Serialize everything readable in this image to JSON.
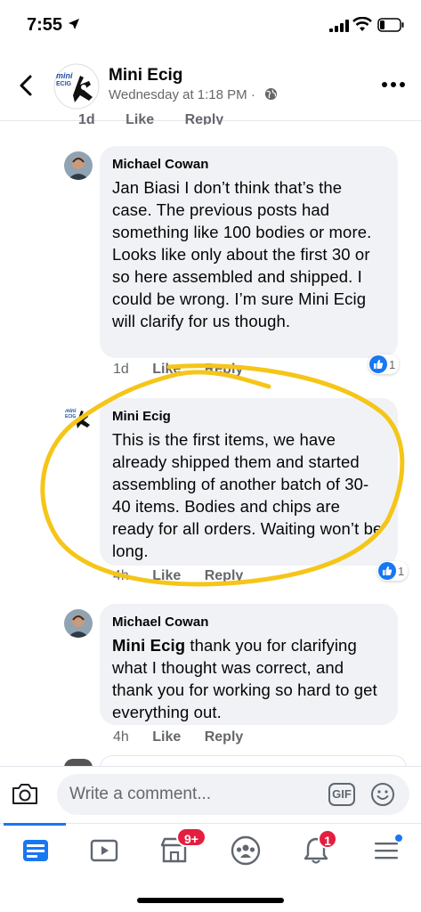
{
  "status_bar": {
    "time": "7:55"
  },
  "header": {
    "page_name": "Mini Ecig",
    "post_meta": "Wednesday at 1:18 PM ·",
    "avatar_logo_text": "mini ECIG"
  },
  "partial_row": {
    "time": "1d",
    "like": "Like",
    "reply": "Reply"
  },
  "comments": [
    {
      "author": "Michael Cowan",
      "text": "Jan Biasi I don’t think that’s the case. The previous posts had something like 100 bodies or more. Looks like only about the first 30 or so here assembled and shipped. I could be wrong. I’m sure Mini Ecig will clarify for us though.",
      "time": "1d",
      "like": "Like",
      "reply": "Reply",
      "reaction_count": "1"
    },
    {
      "author": "Mini Ecig",
      "text": "This is the first items, we have already shipped them and started assembling of another batch of 30-40 items. Bodies and chips are ready for all orders. Waiting won’t be long.",
      "time": "4h",
      "like": "Like",
      "reply": "Reply",
      "reaction_count": "1"
    },
    {
      "author": "Michael Cowan",
      "mention": "Mini Ecig",
      "text": " thank you for clarifying what I thought was correct, and thank you for working so hard to get everything out.",
      "time": "4h",
      "like": "Like",
      "reply": "Reply"
    }
  ],
  "composer": {
    "placeholder": "Write a comment...",
    "gif_label": "GIF"
  },
  "tabbar": {
    "marketplace_badge": "9+",
    "notifications_badge": "1"
  },
  "colors": {
    "accent": "#1877f2",
    "bubble": "#f0f2f5",
    "annotation": "#f5c518",
    "badge": "#e41e3f"
  }
}
